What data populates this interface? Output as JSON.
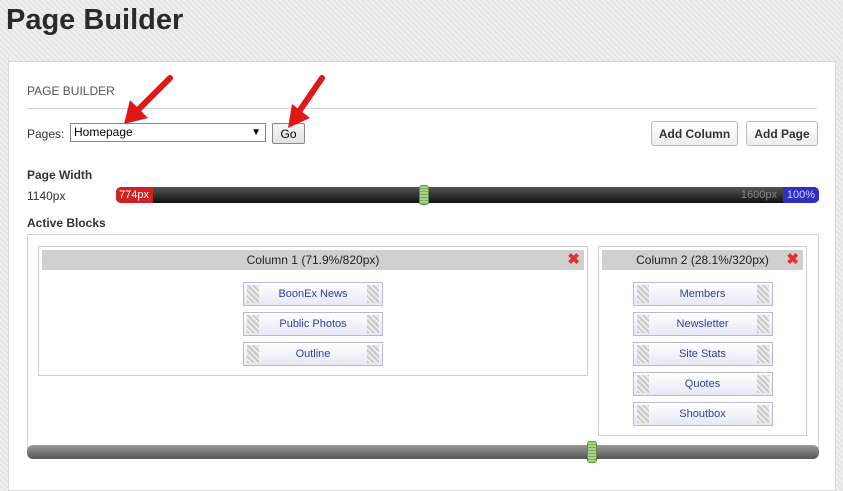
{
  "title": "Page Builder",
  "panel": {
    "header": "PAGE BUILDER",
    "pages_label": "Pages:",
    "pages_selected": "Homepage",
    "go_label": "Go",
    "add_column_label": "Add Column",
    "add_page_label": "Add Page"
  },
  "page_width": {
    "label": "Page Width",
    "value": "1140px",
    "min_label": "774px",
    "max_px_label": "1600px",
    "max_pct_label": "100%"
  },
  "active_blocks": {
    "label": "Active Blocks",
    "columns": [
      {
        "header": "Column 1 (71.9%/820px)",
        "blocks": [
          "BoonEx News",
          "Public Photos",
          "Outline"
        ]
      },
      {
        "header": "Column 2 (28.1%/320px)",
        "blocks": [
          "Members",
          "Newsletter",
          "Site Stats",
          "Quotes",
          "Shoutbox"
        ]
      }
    ]
  },
  "colors": {
    "accent_red": "#e03030",
    "slider_min": "#d02020",
    "slider_max": "#3030c0",
    "handle_green": "#7fb060",
    "block_text": "#2f3fa0"
  }
}
